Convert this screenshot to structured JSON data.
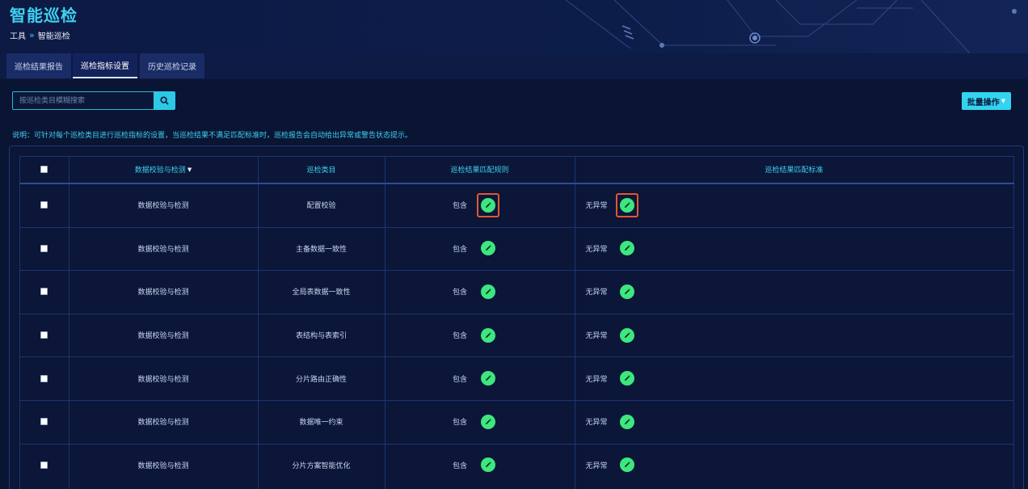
{
  "header": {
    "title": "智能巡检",
    "breadcrumb": {
      "root": "工具",
      "current": "智能巡检"
    }
  },
  "tabs": [
    {
      "label": "巡检结果报告",
      "active": false
    },
    {
      "label": "巡检指标设置",
      "active": true
    },
    {
      "label": "历史巡检记录",
      "active": false
    }
  ],
  "toolbar": {
    "search_placeholder": "按巡检类目模糊搜索",
    "batch_label": "批量操作"
  },
  "note": "说明：可针对每个巡检类目进行巡检指标的设置，当巡检结果不满足匹配标准时，巡检报告会自动给出异常或警告状态提示。",
  "table": {
    "headers": [
      "数据校验与检测",
      "巡检类目",
      "巡检结果匹配规则",
      "巡检结果匹配标准"
    ],
    "rows": [
      {
        "group": "数据校验与检测",
        "category": "配置校验",
        "rule": "包含",
        "standard": "无异常"
      },
      {
        "group": "数据校验与检测",
        "category": "主备数据一致性",
        "rule": "包含",
        "standard": "无异常"
      },
      {
        "group": "数据校验与检测",
        "category": "全局表数据一致性",
        "rule": "包含",
        "standard": "无异常"
      },
      {
        "group": "数据校验与检测",
        "category": "表结构与表索引",
        "rule": "包含",
        "standard": "无异常"
      },
      {
        "group": "数据校验与检测",
        "category": "分片路由正确性",
        "rule": "包含",
        "standard": "无异常"
      },
      {
        "group": "数据校验与检测",
        "category": "数据唯一约束",
        "rule": "包含",
        "standard": "无异常"
      },
      {
        "group": "数据校验与检测",
        "category": "分片方案智能优化",
        "rule": "包含",
        "standard": "无异常"
      }
    ]
  },
  "icons": {
    "search": "search-icon",
    "edit": "pencil-icon"
  },
  "colors": {
    "accent": "#3fd0f0",
    "edit": "#3ee67f",
    "highlight": "#e5562e",
    "background": "#0a1433"
  }
}
